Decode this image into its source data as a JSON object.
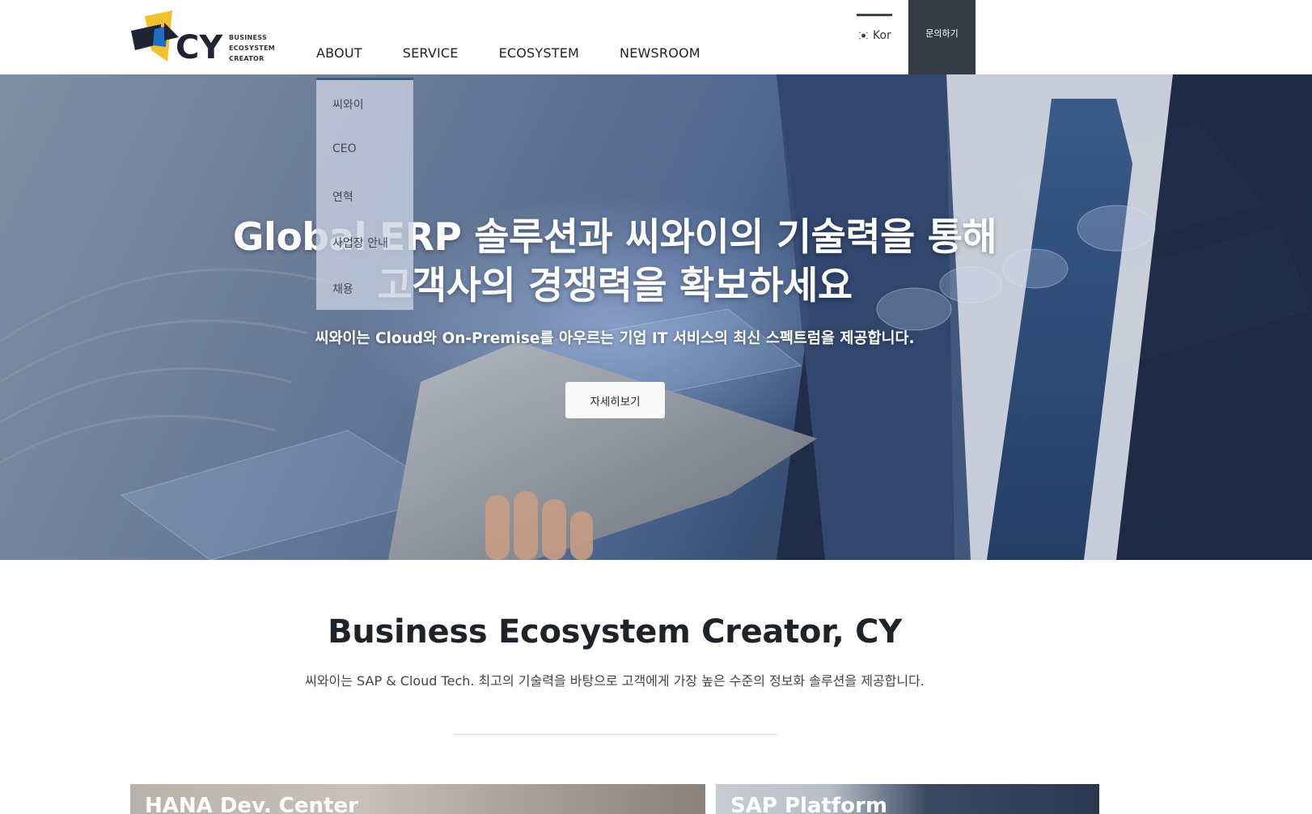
{
  "header": {
    "logo": {
      "letters": "CY",
      "lines": [
        "BUSINESS",
        "ECOSYSTEM",
        "CREATOR"
      ]
    },
    "nav": [
      "ABOUT",
      "SERVICE",
      "ECOSYSTEM",
      "NEWSROOM"
    ],
    "language": "Kor",
    "contact_label": "문의하기"
  },
  "dropdown": {
    "items": [
      "씨와이",
      "CEO",
      "연혁",
      "사업장 안내",
      "채용"
    ]
  },
  "hero": {
    "title_line1": "Global ERP 솔루션과 씨와이의 기술력을 통해",
    "title_line2": "고객사의 경쟁력을 확보하세요",
    "subtitle": "씨와이는 Cloud와 On-Premise를 아우르는 기업 IT 서비스의 최신 스펙트럼을 제공합니다.",
    "button_label": "자세히보기"
  },
  "intro": {
    "title": "Business Ecosystem Creator, CY",
    "text": "씨와이는 SAP & Cloud Tech. 최고의 기술력을 바탕으로 고객에게 가장 높은 수준의 정보화 솔루션을 제공합니다."
  },
  "cards": [
    {
      "title": "HANA Dev. Center"
    },
    {
      "title": "SAP Platform"
    }
  ],
  "colors": {
    "dark_navy": "#363c45",
    "logo_yellow": "#f2c12e",
    "logo_blue": "#1f6fc6",
    "logo_dark": "#1e2433",
    "text_dark": "#1e2229"
  }
}
